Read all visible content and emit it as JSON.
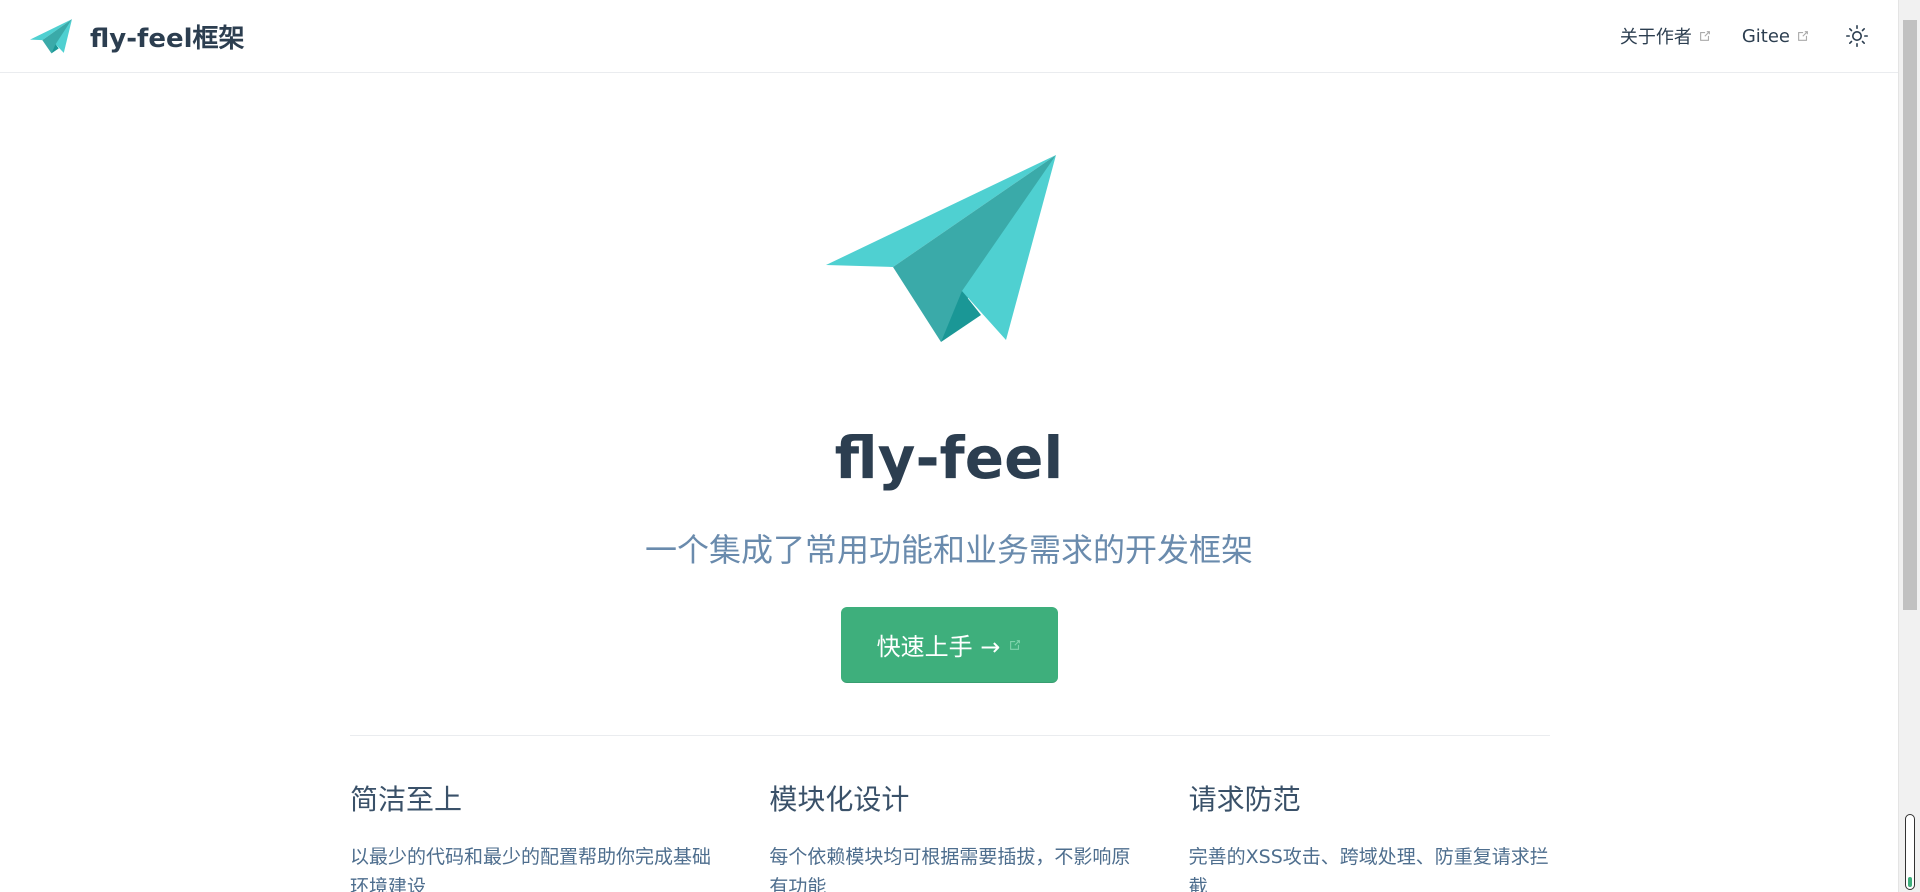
{
  "navbar": {
    "brand_title": "fly-feel框架",
    "links": [
      {
        "label": "关于作者",
        "external": true
      },
      {
        "label": "Gitee",
        "external": true
      }
    ],
    "theme_icon": "sun-icon"
  },
  "hero": {
    "title": "fly-feel",
    "description": "一个集成了常用功能和业务需求的开发框架",
    "action_label": "快速上手 →"
  },
  "features": [
    {
      "title": "简洁至上",
      "desc": "以最少的代码和最少的配置帮助你完成基础环境建设"
    },
    {
      "title": "模块化设计",
      "desc": "每个依赖模块均可根据需要插拔，不影响原有功能"
    },
    {
      "title": "请求防范",
      "desc": "完善的XSS攻击、跨域处理、防重复请求拦截"
    }
  ],
  "colors": {
    "accent": "#3eaf7c",
    "text": "#2c3e50",
    "muted": "#6a8bad",
    "logo_light": "#4fd0d1",
    "logo_mid": "#3aaaa9",
    "logo_dark": "#1a9796"
  }
}
